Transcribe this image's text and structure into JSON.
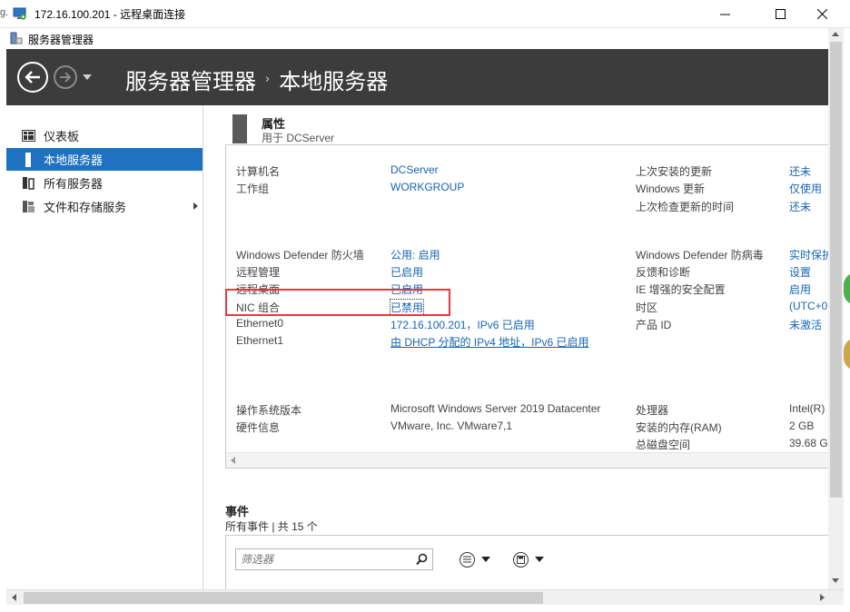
{
  "rdp": {
    "edge_text": "g.",
    "title": "172.16.100.201 - 远程桌面连接"
  },
  "app": {
    "title": "服务器管理器"
  },
  "breadcrumb": {
    "root": "服务器管理器",
    "separator": "›",
    "current": "本地服务器"
  },
  "sidebar": {
    "items": [
      {
        "label": "仪表板",
        "icon": "dashboard-icon"
      },
      {
        "label": "本地服务器",
        "icon": "local-server-icon",
        "active": true
      },
      {
        "label": "所有服务器",
        "icon": "all-servers-icon"
      },
      {
        "label": "文件和存储服务",
        "icon": "file-storage-icon",
        "has_submenu": true
      }
    ]
  },
  "properties": {
    "title": "属性",
    "subtitle": "用于 DCServer",
    "left": [
      {
        "label": "计算机名",
        "value": "DCServer"
      },
      {
        "label": "工作组",
        "value": "WORKGROUP"
      },
      {
        "label": "Windows Defender 防火墙",
        "value": "公用: 启用"
      },
      {
        "label": "远程管理",
        "value": "已启用"
      },
      {
        "label": "远程桌面",
        "value": "已启用"
      },
      {
        "label": "NIC 组合",
        "value": "已禁用"
      },
      {
        "label": "Ethernet0",
        "value": "172.16.100.201，IPv6 已启用"
      },
      {
        "label": "Ethernet1",
        "value": "由 DHCP 分配的 IPv4 地址，IPv6 已启用"
      },
      {
        "label": "操作系统版本",
        "value": "Microsoft Windows Server 2019 Datacenter"
      },
      {
        "label": "硬件信息",
        "value": "VMware, Inc. VMware7,1"
      }
    ],
    "right": [
      {
        "label": "上次安装的更新",
        "value": "还未"
      },
      {
        "label": "Windows 更新",
        "value": "仅使用"
      },
      {
        "label": "上次检查更新的时间",
        "value": "还未"
      },
      {
        "label": "Windows Defender 防病毒",
        "value": "实时保护"
      },
      {
        "label": "反馈和诊断",
        "value": "设置"
      },
      {
        "label": "IE 增强的安全配置",
        "value": "启用"
      },
      {
        "label": "时区",
        "value": "(UTC+0"
      },
      {
        "label": "产品 ID",
        "value": "未激活"
      },
      {
        "label": "处理器",
        "value": "Intel(R)"
      },
      {
        "label": "安装的内存(RAM)",
        "value": "2 GB"
      },
      {
        "label": "总磁盘空间",
        "value": "39.68 G"
      }
    ]
  },
  "events": {
    "title": "事件",
    "subtitle": "所有事件 | 共 15 个",
    "filter_placeholder": "筛选器"
  },
  "colors": {
    "header_bg": "#3c3c3c",
    "accent": "#1e72c0",
    "link": "#1665b4",
    "highlight": "#e8383d"
  }
}
